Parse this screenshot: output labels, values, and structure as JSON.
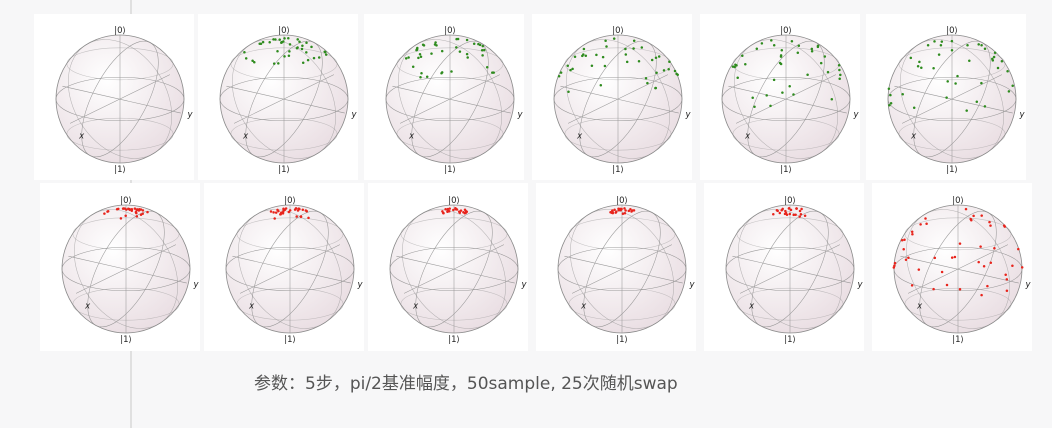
{
  "caption": "参数：5步，pi/2基准幅度，50sample, 25次随机swap",
  "labels": {
    "ket0": "|0⟩",
    "ket1": "|1⟩",
    "x": "x",
    "y": "y"
  },
  "colors": {
    "page": "#f7f7f8",
    "panel": "#ffffff",
    "divider": "#c8c8c8",
    "sphere_fill": "#f1e6ea",
    "wire": "#8a8a8a",
    "green": "#2e8b1e",
    "red": "#e8241c"
  },
  "chart_data": [
    {
      "type": "scatter",
      "title": "",
      "row": 1,
      "col": 1,
      "color": "green",
      "spread": 0.0,
      "points": 0
    },
    {
      "type": "scatter",
      "title": "",
      "row": 1,
      "col": 2,
      "color": "green",
      "spread": 0.45,
      "points": 40
    },
    {
      "type": "scatter",
      "title": "",
      "row": 1,
      "col": 3,
      "color": "green",
      "spread": 0.65,
      "points": 40
    },
    {
      "type": "scatter",
      "title": "",
      "row": 1,
      "col": 4,
      "color": "green",
      "spread": 0.8,
      "points": 40
    },
    {
      "type": "scatter",
      "title": "",
      "row": 1,
      "col": 5,
      "color": "green",
      "spread": 0.95,
      "points": 40
    },
    {
      "type": "scatter",
      "title": "",
      "row": 1,
      "col": 6,
      "color": "green",
      "spread": 1.0,
      "points": 40
    },
    {
      "type": "scatter",
      "title": "",
      "row": 2,
      "col": 1,
      "color": "red",
      "spread": 0.22,
      "points": 30
    },
    {
      "type": "scatter",
      "title": "",
      "row": 2,
      "col": 2,
      "color": "red",
      "spread": 0.25,
      "points": 30
    },
    {
      "type": "scatter",
      "title": "",
      "row": 2,
      "col": 3,
      "color": "red",
      "spread": 0.14,
      "points": 25
    },
    {
      "type": "scatter",
      "title": "",
      "row": 2,
      "col": 4,
      "color": "red",
      "spread": 0.12,
      "points": 25
    },
    {
      "type": "scatter",
      "title": "",
      "row": 2,
      "col": 5,
      "color": "red",
      "spread": 0.2,
      "points": 25
    },
    {
      "type": "scatter",
      "title": "",
      "row": 2,
      "col": 6,
      "color": "red",
      "spread": 1.15,
      "points": 45
    }
  ]
}
